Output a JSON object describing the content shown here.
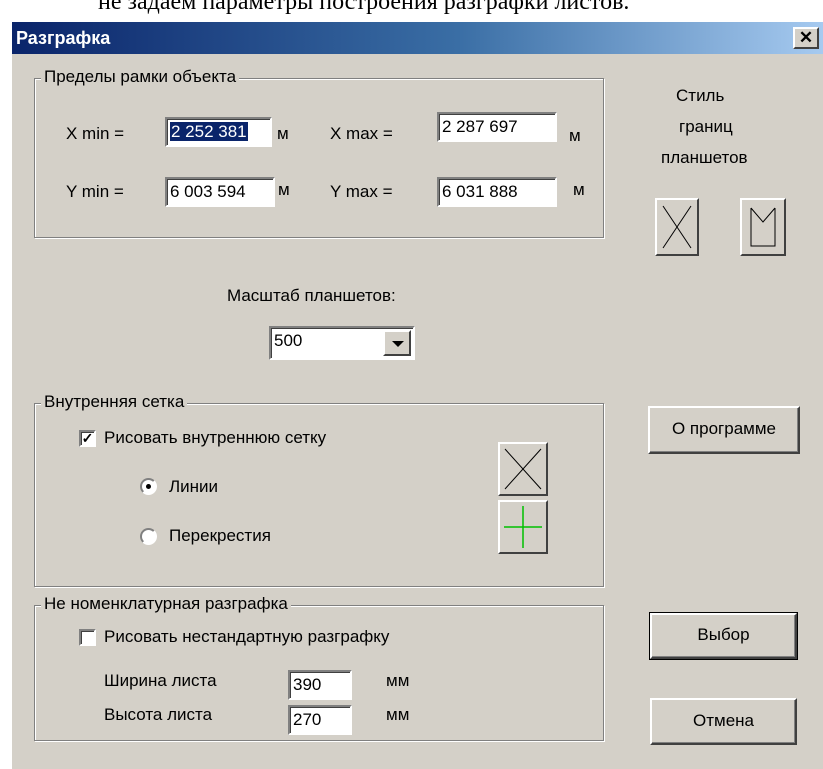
{
  "caption": "не задаем параметры построения разграфки листов.",
  "window": {
    "title": "Разграфка",
    "close_glyph": "✕"
  },
  "bounds": {
    "legend": "Пределы рамки объекта",
    "xmin_label": "X  min =",
    "xmin_value": "2 252 381",
    "xmin_unit": "м",
    "xmax_label": "X  max =",
    "xmax_value": "2 287 697",
    "xmax_unit": "м",
    "ymin_label": "Y  min =",
    "ymin_value": "6 003 594",
    "ymin_unit": "м",
    "ymax_label": "Y  max =",
    "ymax_value": "6 031 888",
    "ymax_unit": "м"
  },
  "style": {
    "line1": "Стиль",
    "line2": "границ",
    "line3": "планшетов",
    "icon_cross": "cross-frame-icon",
    "icon_open": "open-frame-icon"
  },
  "scale": {
    "label": "Масштаб планшетов:",
    "value": "500"
  },
  "grid": {
    "legend": "Внутренняя сетка",
    "draw_label": "Рисовать внутреннюю сетку",
    "draw_checked": true,
    "lines_label": "Линии",
    "lines_selected": true,
    "crosses_label": "Перекрестия",
    "crosses_selected": false,
    "icon_lines": "diagonal-cross-icon",
    "icon_crosses": "green-plus-icon",
    "cross_color": "#00c000"
  },
  "about_button": "О программе",
  "custom": {
    "legend": "Не номенклатурная разграфка",
    "draw_label": "Рисовать нестандартную разграфку",
    "draw_checked": false,
    "width_label": "Ширина листа",
    "width_value": "390",
    "width_unit": "мм",
    "height_label": "Высота листа",
    "height_value": "270",
    "height_unit": "мм"
  },
  "select_button": "Выбор",
  "cancel_button": "Отмена"
}
